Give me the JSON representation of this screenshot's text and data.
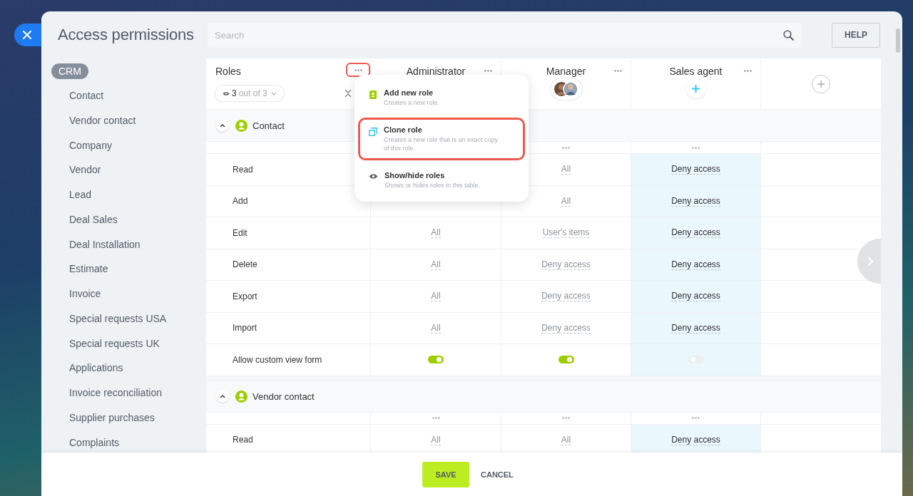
{
  "title": "Access permissions",
  "search": {
    "placeholder": "Search"
  },
  "help_button": "HELP",
  "sidebar": {
    "group": {
      "label": "CRM",
      "selected": true
    },
    "items": [
      "Contact",
      "Vendor contact",
      "Company",
      "Vendor",
      "Lead",
      "Deal Sales",
      "Deal Installation",
      "Estimate",
      "Invoice",
      "Special requests USA",
      "Special requests UK",
      "Applications",
      "Invoice reconciliation",
      "Supplier purchases",
      "Complaints"
    ]
  },
  "table": {
    "roles_header": "Roles",
    "roles_menu_button": {
      "highlighted": true
    },
    "filter": {
      "count": "3",
      "suffix": "out of 3"
    },
    "roles": [
      {
        "name": "Administrator",
        "kind": "none",
        "selected": false
      },
      {
        "name": "Manager",
        "kind": "avatars",
        "selected": false
      },
      {
        "name": "Sales agent",
        "kind": "add",
        "selected": true
      }
    ],
    "sections": [
      {
        "title": "Contact",
        "expanded": true,
        "rows": [
          {
            "label": "Read",
            "kind": "select",
            "values": [
              "All",
              "Deny access"
            ]
          },
          {
            "label": "Add",
            "kind": "select",
            "values": [
              "All",
              "Deny access"
            ]
          },
          {
            "label": "Edit",
            "kind": "select",
            "values": [
              "All",
              "User's items",
              "Deny access"
            ]
          },
          {
            "label": "Delete",
            "kind": "select",
            "values": [
              "All",
              "Deny access",
              "Deny access"
            ]
          },
          {
            "label": "Export",
            "kind": "select",
            "values": [
              "All",
              "Deny access",
              "Deny access"
            ]
          },
          {
            "label": "Import",
            "kind": "select",
            "values": [
              "All",
              "Deny access",
              "Deny access"
            ]
          },
          {
            "label": "Allow custom view form",
            "kind": "toggle",
            "values": [
              true,
              true,
              false
            ]
          }
        ]
      },
      {
        "title": "Vendor contact",
        "expanded": true,
        "rows": [
          {
            "label": "Read",
            "kind": "select",
            "values": [
              "All",
              "All",
              "Deny access"
            ]
          }
        ]
      }
    ]
  },
  "menu": {
    "items": [
      {
        "kind": "add",
        "title": "Add new role",
        "description": "Creates a new role.",
        "highlighted": false
      },
      {
        "kind": "clone",
        "title": "Clone role",
        "description": "Creates a new role that is an exact copy of this role.",
        "highlighted": true
      },
      {
        "kind": "eye",
        "title": "Show/hide roles",
        "description": "Shows or hides roles in this table.",
        "highlighted": false
      }
    ]
  },
  "footer": {
    "save": "SAVE",
    "cancel": "CANCEL"
  }
}
